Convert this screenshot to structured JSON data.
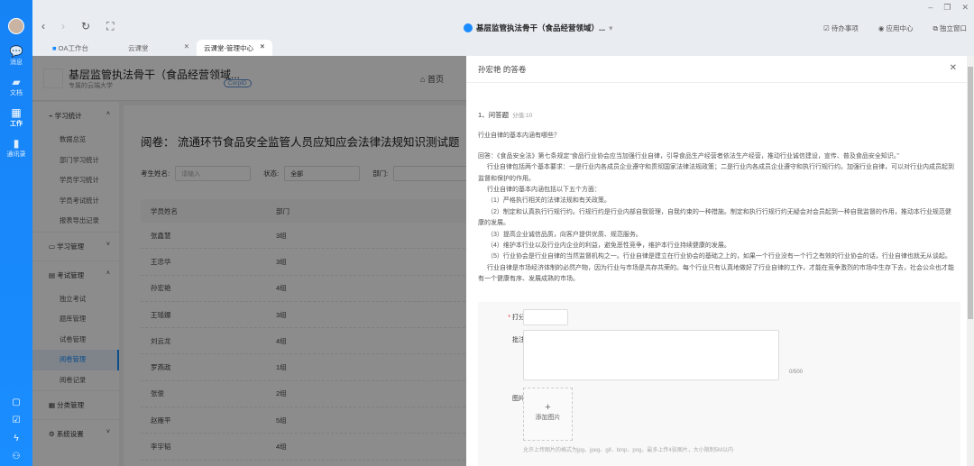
{
  "leftbar": {
    "items": [
      {
        "label": "消息",
        "icon": "chat-icon"
      },
      {
        "label": "文档",
        "icon": "folder-icon"
      },
      {
        "label": "工作",
        "icon": "grid-icon"
      },
      {
        "label": "通讯录",
        "icon": "contacts-icon"
      }
    ]
  },
  "window": {
    "title": "基层监管执法骨干（食品经营领域）...",
    "todo": "待办事项",
    "app_center": "应用中心",
    "standalone": "独立窗口"
  },
  "tabs": [
    {
      "label": "OA工作台"
    },
    {
      "label": "云课堂"
    },
    {
      "label": "云课堂-管理中心"
    }
  ],
  "page": {
    "title": "基层监管执法骨干（食品经营领域...",
    "subtitle": "专属的云端大学",
    "corp": "CorpID",
    "home": "首页"
  },
  "menu": {
    "groups": [
      {
        "label": "学习统计",
        "items": [
          "数据总览",
          "部门学习统计",
          "学员学习统计",
          "学员考试统计",
          "报表导出记录"
        ]
      },
      {
        "label": "学习管理",
        "items": []
      },
      {
        "label": "考试管理",
        "items": [
          "独立考试",
          "题库管理",
          "试卷管理",
          "阅卷管理",
          "阅卷记录"
        ]
      },
      {
        "label": "分类管理",
        "items": []
      },
      {
        "label": "系统设置",
        "items": []
      }
    ]
  },
  "content": {
    "title": "阅卷： 流通环节食品安全监管人员应知应会法律法规知识测试题",
    "filter_name_label": "考生姓名:",
    "filter_name_placeholder": "请输入",
    "filter_status_label": "状态:",
    "filter_status_value": "全部",
    "filter_dept_label": "部门:",
    "columns": [
      "学员姓名",
      "部门"
    ],
    "rows": [
      [
        "张鑫慧",
        "3组"
      ],
      [
        "王忠华",
        "3组"
      ],
      [
        "孙宏艳",
        "4组"
      ],
      [
        "王瑶娜",
        "3组"
      ],
      [
        "刘云龙",
        "4组"
      ],
      [
        "罗燕政",
        "1组"
      ],
      [
        "张俊",
        "2组"
      ],
      [
        "赵雁平",
        "5组"
      ],
      [
        "李宇韬",
        "4组"
      ]
    ]
  },
  "drawer": {
    "title": "孙宏艳 的答卷",
    "question_heading": "1、问答题",
    "score_label": "分值:10",
    "question": "行业自律的基本内涵有哪些？",
    "answer": [
      "回答：《食品安全法》第七条规定“食品行业协会应当加强行业自律，引导食品生产经营者依法生产经营，推动行业诚信建设，宣传、普及食品安全知识。”",
      "行业自律包括两个基本要求：一是行业内各成员企业遵守和贯彻国家法律法规政策；二是行业内各成员企业遵守和执行行规行约。加强行业自律，可以对行业内成员起到监督和保护的作用。",
      "行业自律的基本内涵包括以下五个方面：",
      "（1）严格执行相关的法律法规和有关政策。",
      "（2）制定和认真执行行规行约。行规行约是行业内部自我管理，自我约束的一种措施。制定和执行行规行约无疑会对会员起到一种自我监督的作用，推动本行业规范健康的发展。",
      "（3）提高企业诚信品质，向客户提供优质、规范服务。",
      "（4）维护本行业以及行业内企业的利益，避免恶性竞争，维护本行业持续健康的发展。",
      "（5）行业协会是行业自律的当然监督机构之一。行业自律是建立在行业协会的基础之上的，如果一个行业没有一个行之有效的行业协会的话，行业自律也就无从谈起。",
      "行业自律是市场经济体制的必然产物，因为行业与市场是共存共荣的。每个行业只有认真地做好了行业自律的工作，才能在竞争激烈的市场中生存下去，社会公众也才能有一个健康有序、发展成熟的市场。"
    ],
    "form": {
      "score_label": "打分:",
      "required_mark": "*",
      "note_label": "批注:",
      "counter": "0/500",
      "image_label": "图片:",
      "add_image": "添加图片",
      "hint": "允许上传图片的格式为jpg、jpeg、gif、bmp、png，最多上传4张图片，大小限制5M以内"
    }
  }
}
